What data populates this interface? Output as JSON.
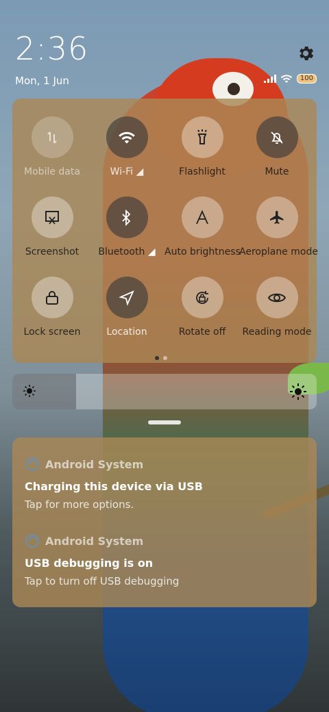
{
  "status": {
    "time": "2:36",
    "date": "Mon, 1 Jun",
    "battery": "100"
  },
  "quick_settings": {
    "tiles": [
      {
        "label": "Mobile data",
        "icon": "mobile-data-icon",
        "state": "disabled"
      },
      {
        "label": "Wi-Fi",
        "icon": "wifi-icon",
        "state": "active"
      },
      {
        "label": "Flashlight",
        "icon": "flashlight-icon",
        "state": "inactive"
      },
      {
        "label": "Mute",
        "icon": "mute-icon",
        "state": "active"
      },
      {
        "label": "Screenshot",
        "icon": "screenshot-icon",
        "state": "inactive"
      },
      {
        "label": "Bluetooth",
        "icon": "bluetooth-icon",
        "state": "active"
      },
      {
        "label": "Auto brightness",
        "icon": "auto-brightness-icon",
        "state": "inactive"
      },
      {
        "label": "Aeroplane mode",
        "icon": "aeroplane-icon",
        "state": "inactive"
      },
      {
        "label": "Lock screen",
        "icon": "lock-icon",
        "state": "inactive"
      },
      {
        "label": "Location",
        "icon": "location-icon",
        "state": "active"
      },
      {
        "label": "Rotate off",
        "icon": "rotate-lock-icon",
        "state": "inactive"
      },
      {
        "label": "Reading mode",
        "icon": "eye-icon",
        "state": "inactive"
      }
    ],
    "page_indicator": {
      "current": 1,
      "total": 2
    }
  },
  "brightness": {
    "level_fraction": 0.21
  },
  "notifications": [
    {
      "app": "Android System",
      "title": "Charging this device via USB",
      "text": "Tap for more options."
    },
    {
      "app": "Android System",
      "title": "USB debugging is on",
      "text": "Tap to turn off USB debugging"
    }
  ],
  "colors": {
    "panel": "#aa8755",
    "active_tile": "#3c3c3c"
  }
}
